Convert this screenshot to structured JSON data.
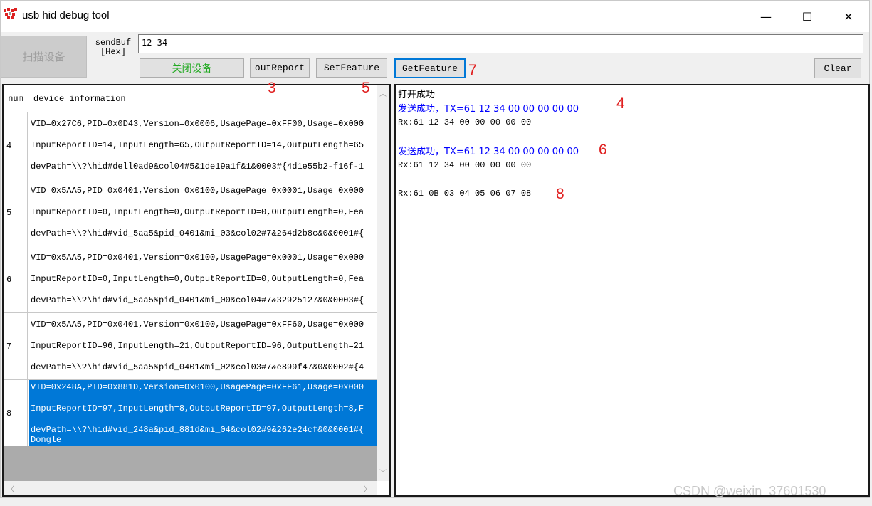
{
  "window": {
    "title": "usb hid debug tool",
    "min_glyph": "—",
    "max_glyph": "☐",
    "close_glyph": "✕"
  },
  "toolbar": {
    "scan_label": "扫描设备",
    "sendbuf_label_1": "sendBuf",
    "sendbuf_label_2": "[Hex]",
    "sendbuf_value": "12 34",
    "close_device_label": "关闭设备",
    "out_report_label": "outReport",
    "set_feature_label": "SetFeature",
    "get_feature_label": "GetFeature",
    "clear_label": "Clear"
  },
  "annotations": [
    "3",
    "5",
    "7",
    "4",
    "6",
    "8"
  ],
  "device_list": {
    "header_num": "num",
    "header_info": "device information",
    "rows": [
      {
        "num": "4",
        "lines": [
          "VID=0x27C6,PID=0x0D43,Version=0x0006,UsagePage=0xFF00,Usage=0x000",
          "InputReportID=14,InputLength=65,OutputReportID=14,OutputLength=65",
          "devPath=\\\\?\\hid#dell0ad9&col04#5&1de19a1f&1&0003#{4d1e55b2-f16f-1"
        ]
      },
      {
        "num": "5",
        "lines": [
          "VID=0x5AA5,PID=0x0401,Version=0x0100,UsagePage=0x0001,Usage=0x000",
          "InputReportID=0,InputLength=0,OutputReportID=0,OutputLength=0,Fea",
          "devPath=\\\\?\\hid#vid_5aa5&pid_0401&mi_03&col02#7&264d2b8c&0&0001#{"
        ]
      },
      {
        "num": "6",
        "lines": [
          "VID=0x5AA5,PID=0x0401,Version=0x0100,UsagePage=0x0001,Usage=0x000",
          "InputReportID=0,InputLength=0,OutputReportID=0,OutputLength=0,Fea",
          "devPath=\\\\?\\hid#vid_5aa5&pid_0401&mi_00&col04#7&32925127&0&0003#{"
        ]
      },
      {
        "num": "7",
        "lines": [
          "VID=0x5AA5,PID=0x0401,Version=0x0100,UsagePage=0xFF60,Usage=0x000",
          "InputReportID=96,InputLength=21,OutputReportID=96,OutputLength=21",
          "devPath=\\\\?\\hid#vid_5aa5&pid_0401&mi_02&col03#7&e899f47&0&0002#{4"
        ]
      },
      {
        "num": "8",
        "lines": [
          "VID=0x248A,PID=0x881D,Version=0x0100,UsagePage=0xFF61,Usage=0x000",
          "InputReportID=97,InputLength=8,OutputReportID=97,OutputLength=8,F",
          "devPath=\\\\?\\hid#vid_248a&pid_881d&mi_04&col02#9&262e24cf&0&0001#{",
          "Dongle"
        ]
      }
    ]
  },
  "log": {
    "lines": [
      "打开成功",
      "发送成功，TX=61 12 34 00 00 00 00 00",
      "Rx:61 12 34 00 00 00 00 00",
      "发送成功，TX=61 12 34 00 00 00 00 00",
      "Rx:61 12 34 00 00 00 00 00",
      "Rx:61 0B 03 04 05 06 07 08"
    ],
    "colors": {
      "normal": "#000000",
      "sent": "#0000ff"
    }
  },
  "watermark": "CSDN @weixin_37601530",
  "colors": {
    "selection": "#0078d7",
    "annotation": "#e02020",
    "focus": "#0078d7"
  }
}
